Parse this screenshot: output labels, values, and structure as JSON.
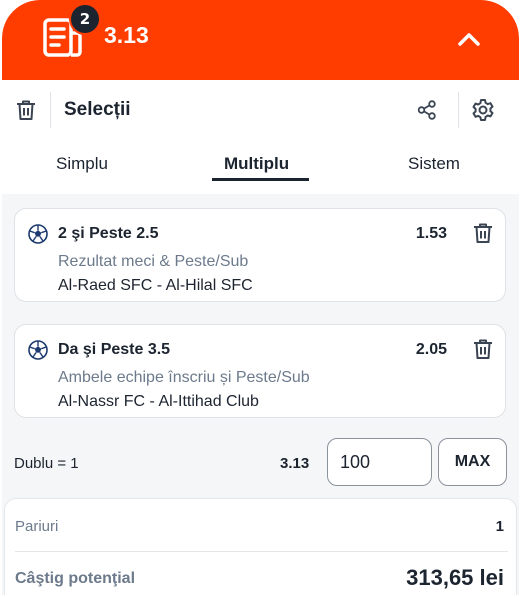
{
  "header": {
    "selection_count": "2",
    "total_odds": "3.13",
    "bg_color": "#ff3d00"
  },
  "toolbar": {
    "title": "Selecții",
    "icons": [
      "trash-icon",
      "share-icon",
      "gear-icon"
    ]
  },
  "tabs": [
    {
      "label": "Simplu",
      "active": false
    },
    {
      "label": "Multiplu",
      "active": true
    },
    {
      "label": "Sistem",
      "active": false
    }
  ],
  "selections": [
    {
      "pick": "2 şi Peste 2.5",
      "odds": "1.53",
      "market": "Rezultat meci & Peste/Sub",
      "match": "Al-Raed SFC - Al-Hilal SFC"
    },
    {
      "pick": "Da şi Peste 3.5",
      "odds": "2.05",
      "market": "Ambele echipe înscriu și Peste/Sub",
      "match": "Al-Nassr FC - Al-Ittihad Club"
    }
  ],
  "bet": {
    "combination_label": "Dublu = 1",
    "combination_odds": "3.13",
    "stake_value": "100",
    "max_label": "MAX"
  },
  "summary": {
    "bets_label": "Pariuri",
    "bets_value": "1",
    "win_label": "Câştig potenţial",
    "win_value": "313,65 lei"
  }
}
